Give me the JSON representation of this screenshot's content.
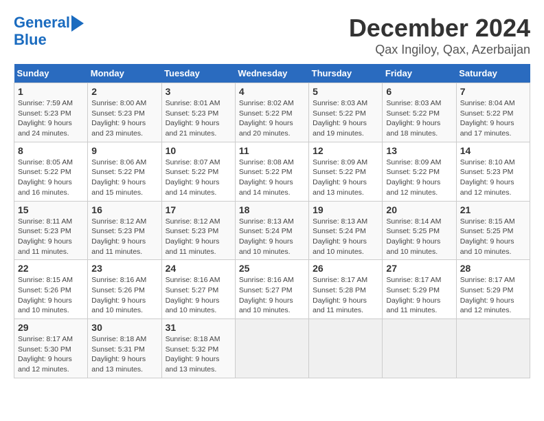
{
  "header": {
    "logo_line1": "General",
    "logo_line2": "Blue",
    "title": "December 2024",
    "subtitle": "Qax Ingiloy, Qax, Azerbaijan"
  },
  "weekdays": [
    "Sunday",
    "Monday",
    "Tuesday",
    "Wednesday",
    "Thursday",
    "Friday",
    "Saturday"
  ],
  "weeks": [
    [
      {
        "day": "1",
        "info": "Sunrise: 7:59 AM\nSunset: 5:23 PM\nDaylight: 9 hours\nand 24 minutes."
      },
      {
        "day": "2",
        "info": "Sunrise: 8:00 AM\nSunset: 5:23 PM\nDaylight: 9 hours\nand 23 minutes."
      },
      {
        "day": "3",
        "info": "Sunrise: 8:01 AM\nSunset: 5:23 PM\nDaylight: 9 hours\nand 21 minutes."
      },
      {
        "day": "4",
        "info": "Sunrise: 8:02 AM\nSunset: 5:22 PM\nDaylight: 9 hours\nand 20 minutes."
      },
      {
        "day": "5",
        "info": "Sunrise: 8:03 AM\nSunset: 5:22 PM\nDaylight: 9 hours\nand 19 minutes."
      },
      {
        "day": "6",
        "info": "Sunrise: 8:03 AM\nSunset: 5:22 PM\nDaylight: 9 hours\nand 18 minutes."
      },
      {
        "day": "7",
        "info": "Sunrise: 8:04 AM\nSunset: 5:22 PM\nDaylight: 9 hours\nand 17 minutes."
      }
    ],
    [
      {
        "day": "8",
        "info": "Sunrise: 8:05 AM\nSunset: 5:22 PM\nDaylight: 9 hours\nand 16 minutes."
      },
      {
        "day": "9",
        "info": "Sunrise: 8:06 AM\nSunset: 5:22 PM\nDaylight: 9 hours\nand 15 minutes."
      },
      {
        "day": "10",
        "info": "Sunrise: 8:07 AM\nSunset: 5:22 PM\nDaylight: 9 hours\nand 14 minutes."
      },
      {
        "day": "11",
        "info": "Sunrise: 8:08 AM\nSunset: 5:22 PM\nDaylight: 9 hours\nand 14 minutes."
      },
      {
        "day": "12",
        "info": "Sunrise: 8:09 AM\nSunset: 5:22 PM\nDaylight: 9 hours\nand 13 minutes."
      },
      {
        "day": "13",
        "info": "Sunrise: 8:09 AM\nSunset: 5:22 PM\nDaylight: 9 hours\nand 12 minutes."
      },
      {
        "day": "14",
        "info": "Sunrise: 8:10 AM\nSunset: 5:23 PM\nDaylight: 9 hours\nand 12 minutes."
      }
    ],
    [
      {
        "day": "15",
        "info": "Sunrise: 8:11 AM\nSunset: 5:23 PM\nDaylight: 9 hours\nand 11 minutes."
      },
      {
        "day": "16",
        "info": "Sunrise: 8:12 AM\nSunset: 5:23 PM\nDaylight: 9 hours\nand 11 minutes."
      },
      {
        "day": "17",
        "info": "Sunrise: 8:12 AM\nSunset: 5:23 PM\nDaylight: 9 hours\nand 11 minutes."
      },
      {
        "day": "18",
        "info": "Sunrise: 8:13 AM\nSunset: 5:24 PM\nDaylight: 9 hours\nand 10 minutes."
      },
      {
        "day": "19",
        "info": "Sunrise: 8:13 AM\nSunset: 5:24 PM\nDaylight: 9 hours\nand 10 minutes."
      },
      {
        "day": "20",
        "info": "Sunrise: 8:14 AM\nSunset: 5:25 PM\nDaylight: 9 hours\nand 10 minutes."
      },
      {
        "day": "21",
        "info": "Sunrise: 8:15 AM\nSunset: 5:25 PM\nDaylight: 9 hours\nand 10 minutes."
      }
    ],
    [
      {
        "day": "22",
        "info": "Sunrise: 8:15 AM\nSunset: 5:26 PM\nDaylight: 9 hours\nand 10 minutes."
      },
      {
        "day": "23",
        "info": "Sunrise: 8:16 AM\nSunset: 5:26 PM\nDaylight: 9 hours\nand 10 minutes."
      },
      {
        "day": "24",
        "info": "Sunrise: 8:16 AM\nSunset: 5:27 PM\nDaylight: 9 hours\nand 10 minutes."
      },
      {
        "day": "25",
        "info": "Sunrise: 8:16 AM\nSunset: 5:27 PM\nDaylight: 9 hours\nand 10 minutes."
      },
      {
        "day": "26",
        "info": "Sunrise: 8:17 AM\nSunset: 5:28 PM\nDaylight: 9 hours\nand 11 minutes."
      },
      {
        "day": "27",
        "info": "Sunrise: 8:17 AM\nSunset: 5:29 PM\nDaylight: 9 hours\nand 11 minutes."
      },
      {
        "day": "28",
        "info": "Sunrise: 8:17 AM\nSunset: 5:29 PM\nDaylight: 9 hours\nand 12 minutes."
      }
    ],
    [
      {
        "day": "29",
        "info": "Sunrise: 8:17 AM\nSunset: 5:30 PM\nDaylight: 9 hours\nand 12 minutes."
      },
      {
        "day": "30",
        "info": "Sunrise: 8:18 AM\nSunset: 5:31 PM\nDaylight: 9 hours\nand 13 minutes."
      },
      {
        "day": "31",
        "info": "Sunrise: 8:18 AM\nSunset: 5:32 PM\nDaylight: 9 hours\nand 13 minutes."
      },
      {
        "day": "",
        "info": ""
      },
      {
        "day": "",
        "info": ""
      },
      {
        "day": "",
        "info": ""
      },
      {
        "day": "",
        "info": ""
      }
    ]
  ]
}
